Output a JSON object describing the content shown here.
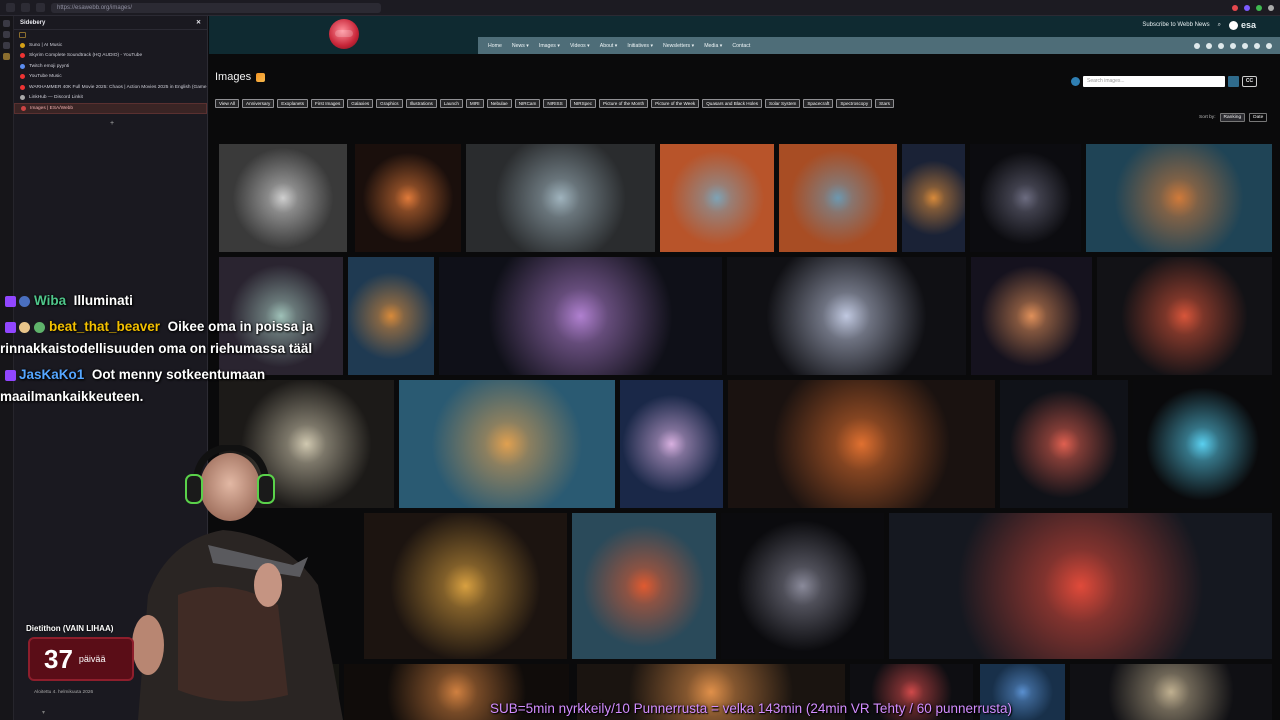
{
  "browser": {
    "url": "https://esawebb.org/images/"
  },
  "sidebar": {
    "title": "Sidebery",
    "tabs": [
      {
        "label": "Suno | AI Music",
        "color": "#d4a017"
      },
      {
        "label": "Skyrim Complete Soundtrack (HQ AUDIO) - YouTube",
        "color": "#e33"
      },
      {
        "label": "Twitch emoji pyynti",
        "color": "#5b8def"
      },
      {
        "label": "YouTube Music",
        "color": "#e33"
      },
      {
        "label": "WARHAMMER 40K Full Movie 2025: Chaos | Action Movies 2025 in English (Game",
        "color": "#e33"
      },
      {
        "label": "LinkHub — Discord Linkit",
        "color": "#aaa"
      },
      {
        "label": "Images | ESA/Webb",
        "color": "#c44"
      }
    ]
  },
  "site": {
    "util": {
      "subscribe": "Subscribe to Webb News",
      "brand": "esa"
    },
    "nav": [
      "Home",
      "News ▾",
      "Images ▾",
      "Videos ▾",
      "About ▾",
      "Initiatives ▾",
      "Newsletters ▾",
      "Media ▾",
      "Contact"
    ],
    "heading": "Images",
    "search_placeholder": "Search images...",
    "cc": "CC",
    "filters": [
      "View All",
      "Anniversary",
      "Exoplanets",
      "First Images",
      "Galaxies",
      "Graphics",
      "Illustrations",
      "Launch",
      "MIRI",
      "Nebulae",
      "NIRCam",
      "NIRISS",
      "NIRSpec",
      "Picture of the Month",
      "Picture of the Week",
      "Quasars and Black Holes",
      "Solar System",
      "Spacecraft",
      "Spectroscopy",
      "Stars"
    ],
    "sort_label": "Sort by:",
    "sort_options": [
      "Ranking",
      "Date"
    ]
  },
  "chat": [
    {
      "user": "Wiba",
      "message": "Illuminati"
    },
    {
      "user": "beat_that_beaver",
      "message": "Oikee oma in poissa ja rinnakkaistodellisuuden oma on riehumassa tääl"
    },
    {
      "user": "JasKaKo1",
      "message": "Oot menny sotkeentumaan maailmankaikkeuteen."
    }
  ],
  "counter": {
    "label": "Dietithon (VAIN LIHAA)",
    "value": "37",
    "unit": "päivää",
    "started": "Aloitettu 4. helmikuuta 2026"
  },
  "subtitle": "SUB=5min nyrkkeily/10 Punnerrusta = velka 143min (24min VR Tehty / 60 punnerrusta)"
}
